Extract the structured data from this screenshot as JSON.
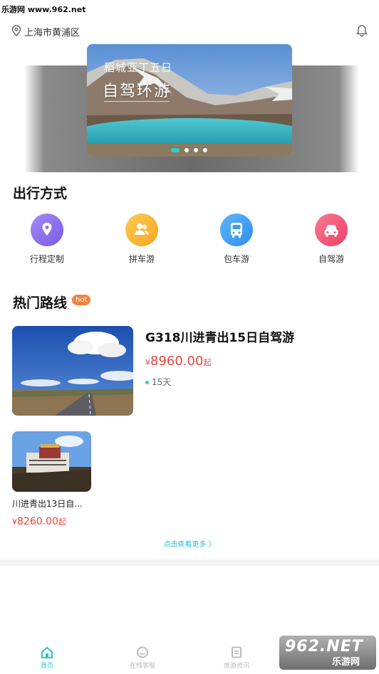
{
  "watermark_top": "乐游网 www.962.net",
  "header": {
    "location": "上海市黄浦区",
    "bell_icon": "bell-icon",
    "location_icon": "location-pin-icon"
  },
  "banner": {
    "subtitle": "稻城亚丁五日",
    "title": "自驾环游",
    "active_slide": 1,
    "slide_count": 4
  },
  "travel_modes": {
    "title": "出行方式",
    "items": [
      {
        "label": "行程定制",
        "icon": "location-icon",
        "color": "#8b6cf0"
      },
      {
        "label": "拼车游",
        "icon": "users-icon",
        "color": "#f8b733"
      },
      {
        "label": "包车游",
        "icon": "bus-icon",
        "color": "#3a9ef5"
      },
      {
        "label": "自驾游",
        "icon": "car-icon",
        "color": "#f25a78"
      }
    ]
  },
  "hot_routes": {
    "title": "热门路线",
    "badge": "hot",
    "routes": [
      {
        "title": "G318川进青出15日自驾游",
        "currency": "¥",
        "price": "8960.00",
        "suffix": "起",
        "days": "15天"
      },
      {
        "title": "川进青出13日自...",
        "currency": "¥",
        "price": "8260.00",
        "suffix": "起"
      }
    ],
    "more_label": "点击查看更多 〉"
  },
  "tabbar": {
    "items": [
      {
        "label": "首页",
        "icon": "home-icon",
        "active": true
      },
      {
        "label": "在线客服",
        "icon": "chat-icon",
        "active": false
      },
      {
        "label": "旅游资讯",
        "icon": "news-icon",
        "active": false
      }
    ]
  },
  "watermark_br": {
    "big": "962.NET",
    "small": "乐游网"
  },
  "colors": {
    "accent": "#2ec2d4",
    "price": "#e8453c",
    "hot_badge": "#f2823b"
  }
}
